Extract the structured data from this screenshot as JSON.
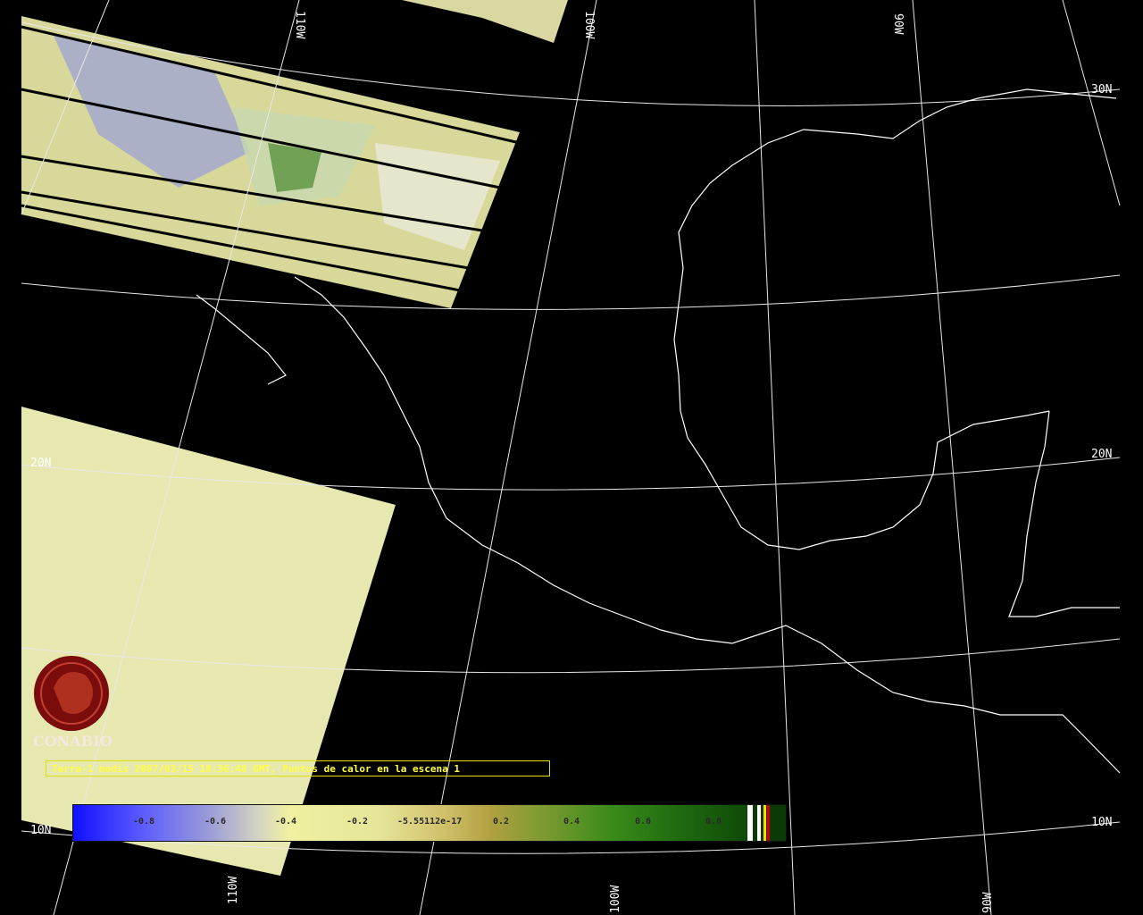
{
  "map": {
    "graticule_labels": {
      "lat_30": "30N",
      "lat_20_right": "20N",
      "lat_20_left": "20N",
      "lat_10_right": "10N",
      "lat_10_left": "10N",
      "lon_110_top": "110W",
      "lon_100_top": "100W",
      "lon_90_top": "90W",
      "lon_110_bottom": "110W",
      "lon_100_bottom": "100W",
      "lon_90_bottom": "90W"
    }
  },
  "logo": {
    "text": "CONABIO"
  },
  "caption": {
    "text": "Terra-1 modis 2007/03/15 18:36:48 GMT, Puntos de calor en la escena 1"
  },
  "colorbar": {
    "ticks": [
      "-0.8",
      "-0.6",
      "-0.4",
      "-0.2",
      "-5.55112e-17",
      "0.2",
      "0.4",
      "0.6",
      "0.8"
    ]
  },
  "colors": {
    "background": "#000000",
    "graticule": "#e8e8e8",
    "coastline": "#ffffff",
    "caption_text": "#ffff40",
    "logo": "#8a1010"
  }
}
